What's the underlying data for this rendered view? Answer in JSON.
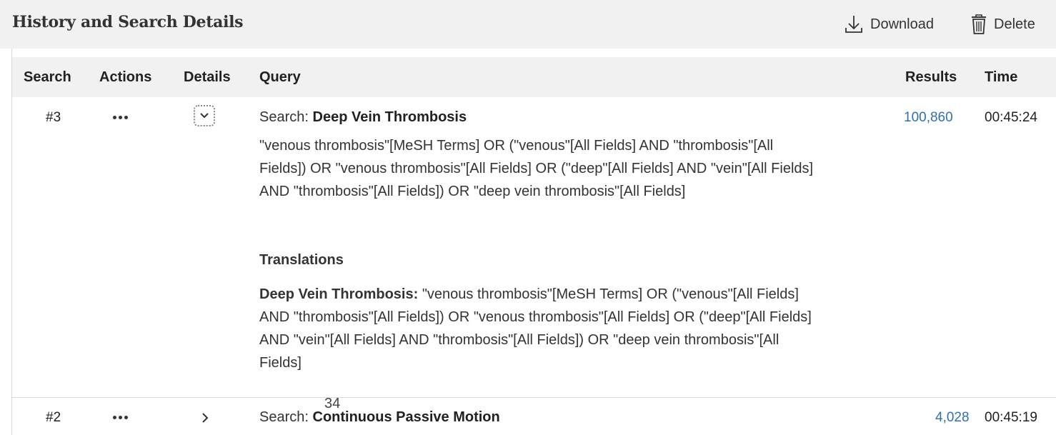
{
  "header": {
    "title": "History and Search Details",
    "download_label": "Download",
    "delete_label": "Delete"
  },
  "table": {
    "columns": {
      "search": "Search",
      "actions": "Actions",
      "details": "Details",
      "query": "Query",
      "results": "Results",
      "time": "Time"
    },
    "rows": [
      {
        "number": "#3",
        "search_prefix": "Search:",
        "search_term": "Deep Vein Thrombosis",
        "query_details": "\"venous thrombosis\"[MeSH Terms] OR (\"venous\"[All Fields] AND \"thrombosis\"[All Fields]) OR \"venous thrombosis\"[All Fields] OR (\"deep\"[All Fields] AND \"vein\"[All Fields] AND \"thrombosis\"[All Fields]) OR \"deep vein thrombosis\"[All Fields]",
        "translations_heading": "Translations",
        "translation_term": "Deep Vein Thrombosis:",
        "translation_text": "\"venous thrombosis\"[MeSH Terms] OR (\"venous\"[All Fields] AND \"thrombosis\"[All Fields]) OR \"venous thrombosis\"[All Fields] OR (\"deep\"[All Fields] AND \"vein\"[All Fields] AND \"thrombosis\"[All Fields]) OR \"deep vein thrombosis\"[All Fields]",
        "results": "100,860",
        "time": "00:45:24",
        "expanded": true
      },
      {
        "number": "#2",
        "search_prefix": "Search:",
        "search_term": "Continuous Passive Motion",
        "results": "4,028",
        "time": "00:45:19",
        "expanded": false
      }
    ]
  },
  "page_number": "34",
  "colors": {
    "link": "#2f6fb3",
    "header_bg": "#f1f1f1",
    "text": "#212121"
  },
  "icons": [
    "download-icon",
    "trash-icon",
    "more-actions-icon",
    "chevron-down-icon",
    "chevron-right-icon"
  ]
}
